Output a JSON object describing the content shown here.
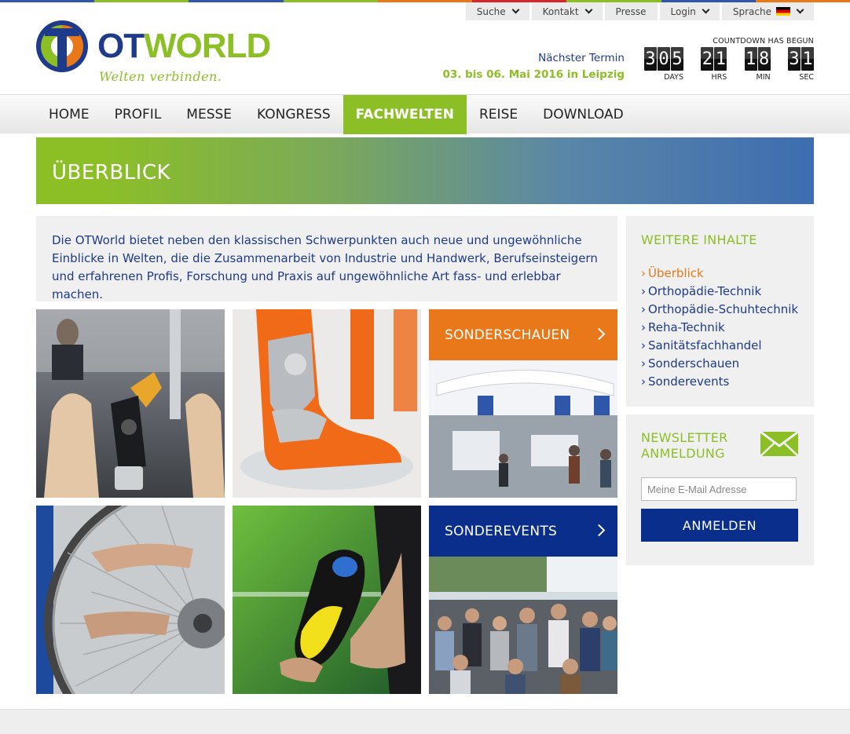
{
  "colors": {
    "brand_green": "#8cbf26",
    "brand_blue": "#1e3a8a",
    "accent_orange": "#e8781a",
    "button_blue": "#0a2e8c",
    "top_stripe": [
      "#2f56a8",
      "#8cbf26",
      "#2f56a8",
      "#8cbf26",
      "#e8781a",
      "#d9262e",
      "#8cbf26",
      "#2f56a8",
      "#e8781a"
    ]
  },
  "util_nav": [
    {
      "label": "Suche",
      "icon": "chevron-down-icon"
    },
    {
      "label": "Kontakt",
      "icon": "chevron-down-icon"
    },
    {
      "label": "Presse"
    },
    {
      "label": "Login",
      "icon": "chevron-down-icon"
    },
    {
      "label": "Sprache",
      "icon": "german-flag-icon"
    }
  ],
  "logo": {
    "text_ot": "OT",
    "text_world": "WORLD",
    "tagline": "Welten verbinden."
  },
  "next_event": {
    "label": "Nächster Termin",
    "date": "03. bis 06. Mai 2016 in Leipzig"
  },
  "countdown": {
    "title": "COUNTDOWN HAS BEGUN",
    "units": [
      {
        "value": "305",
        "label": "DAYS"
      },
      {
        "value": "21",
        "label": "HRS"
      },
      {
        "value": "18",
        "label": "MIN"
      },
      {
        "value": "31",
        "label": "SEC"
      }
    ]
  },
  "main_nav": {
    "items": [
      "HOME",
      "PROFIL",
      "MESSE",
      "KONGRESS",
      "FACHWELTEN",
      "REISE",
      "DOWNLOAD"
    ],
    "active": "FACHWELTEN"
  },
  "banner": {
    "title": "ÜBERBLICK"
  },
  "intro": {
    "text": "Die OTWorld bietet neben den klassischen Schwerpunkten auch neue und ungewöhnliche Einblicke in Welten, die die Zusammenarbeit von Industrie und Handwerk, Berufseinsteigern und erfahrenen Profis, Forschung und Praxis auf ungewöhnliche Art fass- und erlebbar machen."
  },
  "tiles": {
    "sonderschauen": {
      "label": "SONDERSCHAUEN",
      "color": "#e8781a"
    },
    "sonderevents": {
      "label": "SONDEREVENTS",
      "color": "#0a2e8c"
    }
  },
  "sidebar": {
    "title": "WEITERE INHALTE",
    "bullet": "›",
    "items": [
      {
        "label": "Überblick",
        "current": true
      },
      {
        "label": "Orthopädie-Technik"
      },
      {
        "label": "Orthopädie-Schuhtechnik"
      },
      {
        "label": "Reha-Technik"
      },
      {
        "label": "Sanitätsfachhandel"
      },
      {
        "label": "Sonderschauen"
      },
      {
        "label": "Sonderevents"
      }
    ]
  },
  "newsletter": {
    "title": "NEWSLETTER ANMELDUNG",
    "icon": "envelope-icon",
    "placeholder": "Meine E-Mail Adresse",
    "button": "ANMELDEN"
  }
}
